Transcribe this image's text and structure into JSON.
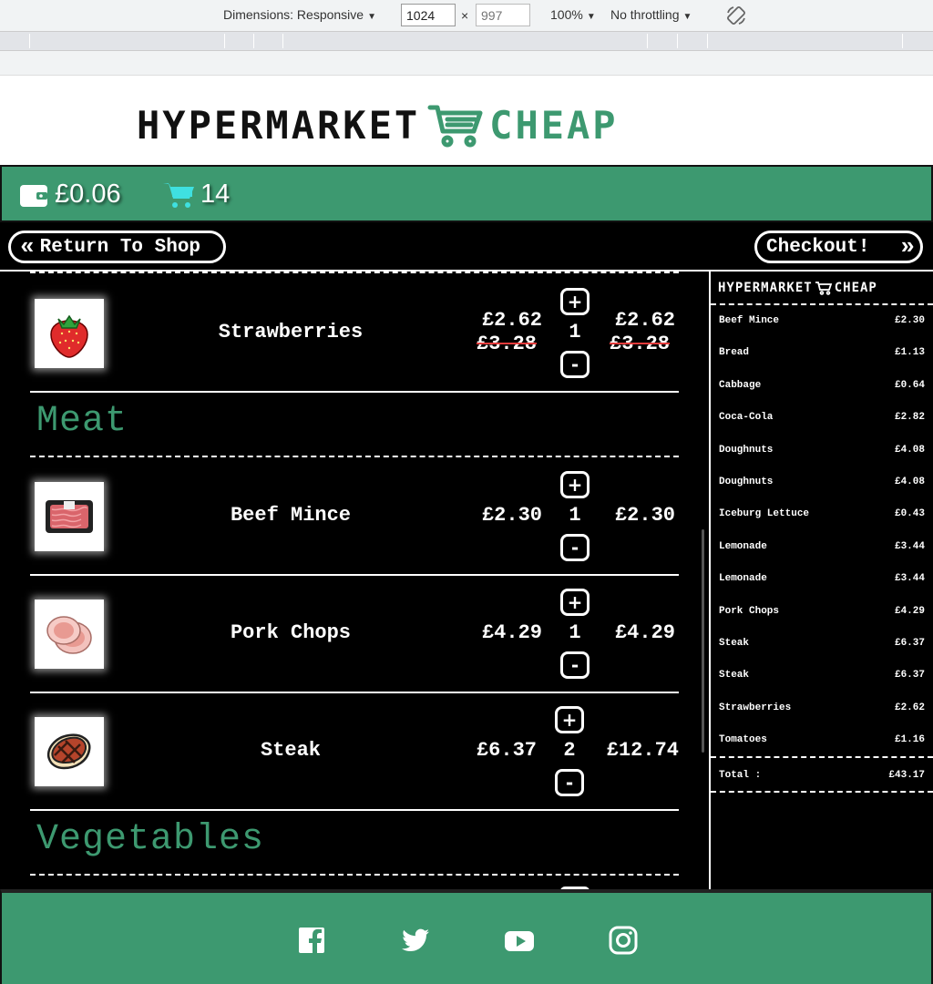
{
  "devtools": {
    "dimensions_label": "Dimensions: Responsive",
    "width": "1024",
    "x_sign": "×",
    "height_placeholder": "997",
    "zoom": "100%",
    "throttling": "No throttling"
  },
  "header": {
    "logo_part1": "HYPERMARKET",
    "logo_part2": "CHEAP"
  },
  "status": {
    "wallet_amount": "£0.06",
    "cart_count": "14"
  },
  "nav": {
    "back_label": "Return To Shop",
    "next_label": "Checkout!"
  },
  "basket": {
    "categories": [
      "Meat",
      "Vegetables"
    ],
    "items": [
      {
        "name": "Strawberries",
        "price": "£2.62",
        "old_price": "£3.28",
        "qty": "1",
        "total": "£2.62",
        "old_total": "£3.28",
        "icon": "strawberry-icon"
      },
      {
        "name": "Beef Mince",
        "price": "£2.30",
        "qty": "1",
        "total": "£2.30",
        "icon": "beef-mince-icon"
      },
      {
        "name": "Pork Chops",
        "price": "£4.29",
        "qty": "1",
        "total": "£4.29",
        "icon": "pork-chops-icon"
      },
      {
        "name": "Steak",
        "price": "£6.37",
        "qty": "2",
        "total": "£12.74",
        "icon": "steak-icon"
      }
    ],
    "plus": "+",
    "minus": "-"
  },
  "receipt": {
    "logo_part1": "HYPERMARKET",
    "logo_part2": "CHEAP",
    "lines": [
      {
        "name": "Beef Mince",
        "price": "£2.30"
      },
      {
        "name": "Bread",
        "price": "£1.13"
      },
      {
        "name": "Cabbage",
        "price": "£0.64"
      },
      {
        "name": "Coca-Cola",
        "price": "£2.82"
      },
      {
        "name": "Doughnuts",
        "price": "£4.08"
      },
      {
        "name": "Doughnuts",
        "price": "£4.08"
      },
      {
        "name": "Iceburg Lettuce",
        "price": "£0.43"
      },
      {
        "name": "Lemonade",
        "price": "£3.44"
      },
      {
        "name": "Lemonade",
        "price": "£3.44"
      },
      {
        "name": "Pork Chops",
        "price": "£4.29"
      },
      {
        "name": "Steak",
        "price": "£6.37"
      },
      {
        "name": "Steak",
        "price": "£6.37"
      },
      {
        "name": "Strawberries",
        "price": "£2.62"
      },
      {
        "name": "Tomatoes",
        "price": "£1.16"
      }
    ],
    "total_label": "Total :",
    "total_value": "£43.17"
  },
  "footer": {
    "icons": [
      "facebook-icon",
      "twitter-icon",
      "youtube-icon",
      "instagram-icon"
    ]
  },
  "colors": {
    "brand_green": "#3d9970",
    "background": "#000000",
    "strike_red": "#e23b3b"
  }
}
